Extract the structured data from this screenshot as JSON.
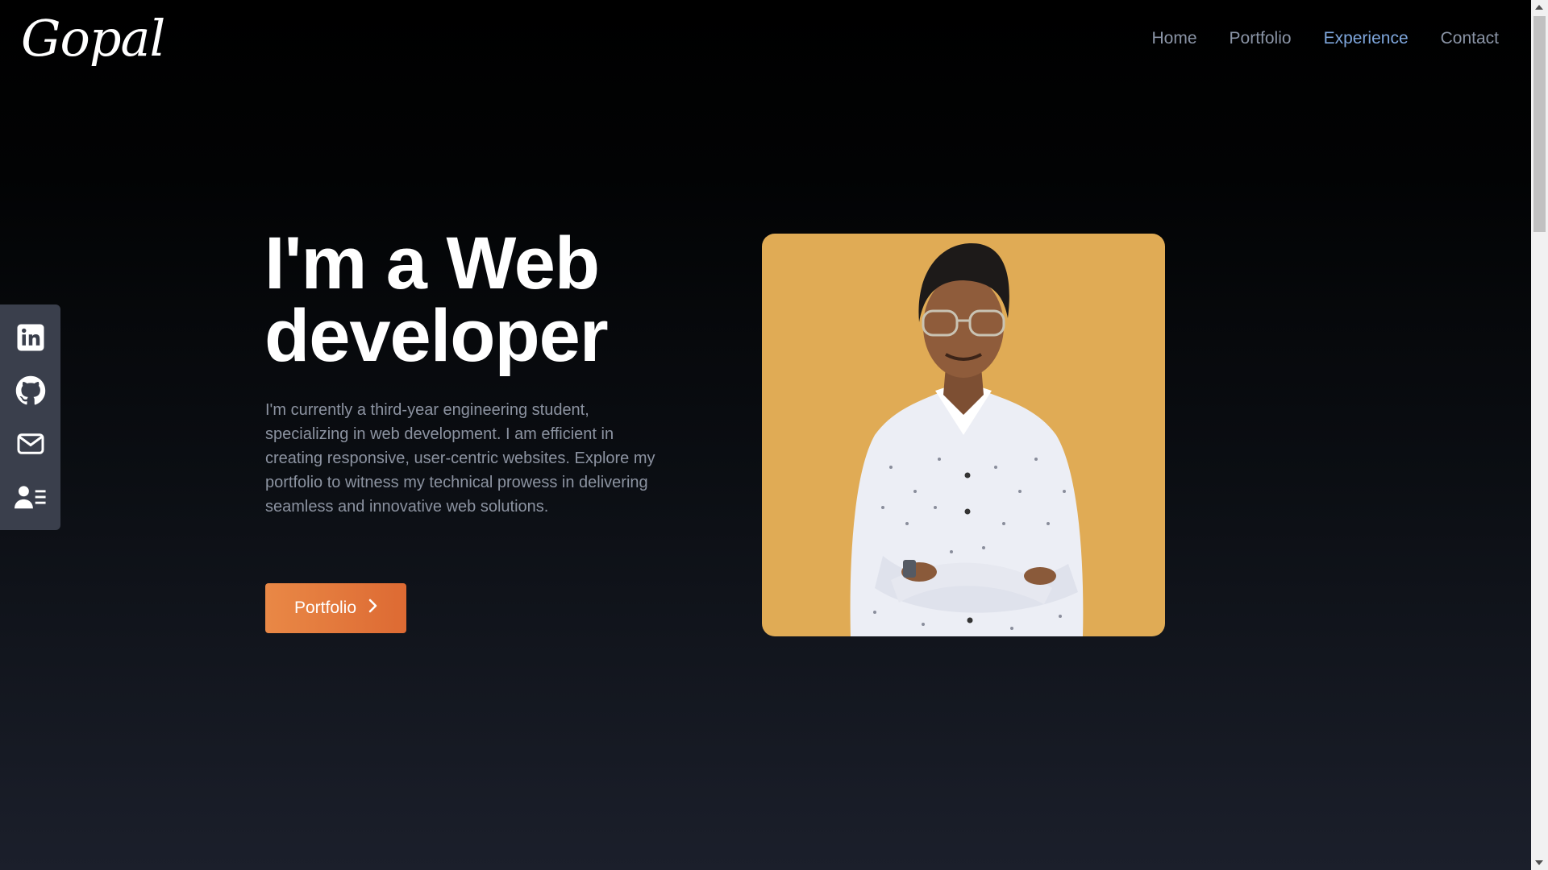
{
  "logo": {
    "text": "Gopal"
  },
  "nav": {
    "items": [
      {
        "label": "Home"
      },
      {
        "label": "Portfolio"
      },
      {
        "label": "Experience"
      },
      {
        "label": "Contact"
      }
    ],
    "active": "Experience"
  },
  "social": {
    "icons": [
      "linkedin-icon",
      "github-icon",
      "mail-icon",
      "resume-icon"
    ]
  },
  "hero": {
    "headline_line1": "I'm a Web",
    "headline_line2": "developer",
    "intro": "I'm currently a third-year engineering student, specializing in web development. I am efficient in creating responsive, user-centric websites. Explore my portfolio to witness my technical prowess in delivering seamless and innovative web solutions.",
    "cta_label": "Portfolio"
  },
  "colors": {
    "accent_orange": "#e07a3c",
    "nav_active": "#7ea6dc",
    "photo_bg": "#e0ab55"
  }
}
